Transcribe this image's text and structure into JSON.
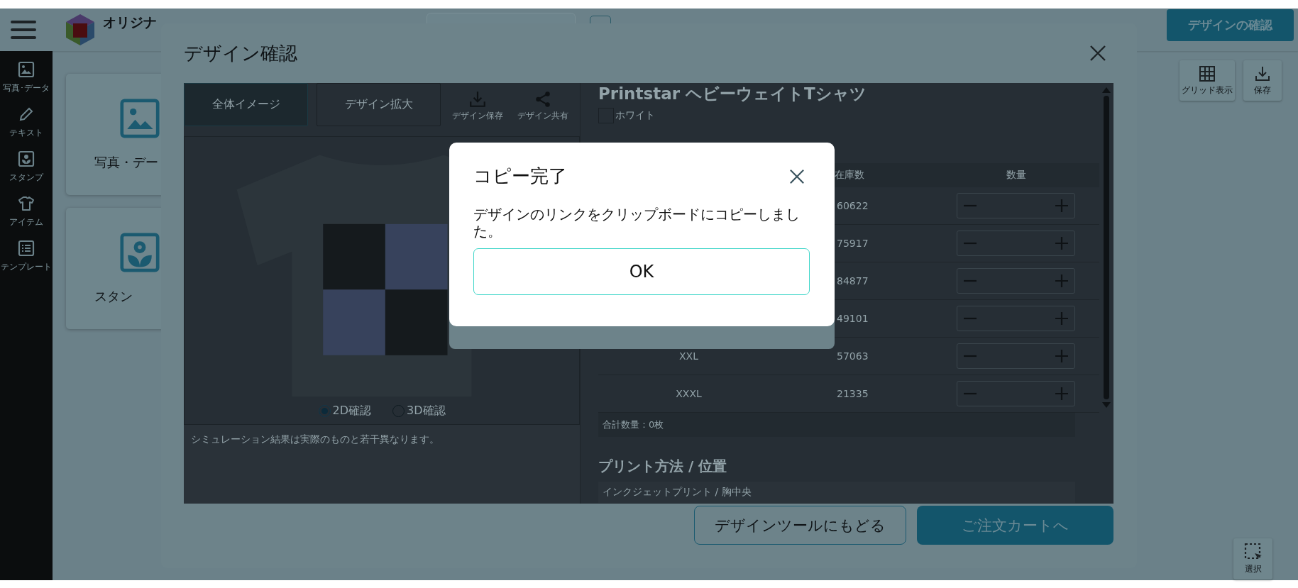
{
  "header": {
    "logo_text": "オリジナ",
    "confirm_button": "デザインの確認"
  },
  "sidebar": {
    "items": [
      {
        "label": "写真･データ",
        "kind": "photo"
      },
      {
        "label": "テキスト",
        "kind": "pencil"
      },
      {
        "label": "スタンプ",
        "kind": "stamp"
      },
      {
        "label": "アイテム",
        "kind": "shirt"
      },
      {
        "label": "テンプレート",
        "kind": "list"
      }
    ]
  },
  "cards": [
    {
      "label": "写真・デー",
      "kind": "photo"
    },
    {
      "label": "スタン",
      "kind": "stamp"
    }
  ],
  "tools": [
    {
      "label": "グリッド表示",
      "kind": "grid"
    },
    {
      "label": "保存",
      "kind": "download"
    }
  ],
  "bottom_tool": {
    "label": "選択",
    "kind": "select"
  },
  "modal": {
    "title": "デザイン確認",
    "tabs": [
      {
        "label": "全体イメージ",
        "selected": true
      },
      {
        "label": "デザイン拡大",
        "selected": false
      }
    ],
    "actions": [
      {
        "label": "デザイン保存",
        "kind": "download"
      },
      {
        "label": "デザイン共有",
        "kind": "share"
      }
    ],
    "view_options": [
      {
        "label": "2D確認",
        "selected": true
      },
      {
        "label": "3D確認",
        "selected": false
      }
    ],
    "notice": "シミュレーション結果は実際のものと若干異なります。",
    "product": {
      "title": "Printstar ヘビーウェイトTシャツ",
      "color_option": {
        "label": "ホワイト",
        "checked": false
      }
    },
    "table": {
      "stock_heading": "在庫数",
      "quantity_heading": "数量",
      "rows": [
        {
          "stock": "60622"
        },
        {
          "stock": "75917"
        },
        {
          "stock": "84877"
        },
        {
          "stock": "49101"
        },
        {
          "size": "XXL",
          "stock": "57063"
        },
        {
          "size": "XXXL",
          "stock": "21335"
        }
      ],
      "total": "合計数量：0枚"
    },
    "print_section": {
      "heading": "プリント方法 / 位置",
      "value": "インクジェットプリント / 胸中央"
    },
    "back_button": "デザインツールにもどる",
    "cart_button": "ご注文カートへ"
  },
  "dialog": {
    "title": "コピー完了",
    "message": "デザインのリンクをクリップボードにコピーしました。",
    "ok_button": "OK"
  }
}
